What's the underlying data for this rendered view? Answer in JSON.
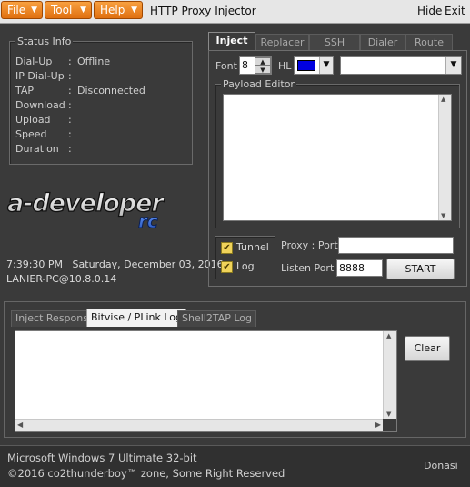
{
  "menu": {
    "file": "File",
    "tool": "Tool",
    "help": "Help"
  },
  "window": {
    "title": "HTTP Proxy Injector",
    "hide": "Hide",
    "exit": "Exit"
  },
  "status_info": {
    "legend": "Status Info",
    "rows": [
      {
        "label": "Dial-Up",
        "value": "Offline"
      },
      {
        "label": "IP Dial-Up",
        "value": ""
      },
      {
        "label": "TAP",
        "value": "Disconnected"
      },
      {
        "label": "Download",
        "value": ""
      },
      {
        "label": "Upload",
        "value": ""
      },
      {
        "label": "Speed",
        "value": ""
      },
      {
        "label": "Duration",
        "value": ""
      }
    ]
  },
  "clock": {
    "time": "7:39:30 PM",
    "date": "Saturday, December 03, 2016",
    "host": "LANIER-PC@10.8.0.14"
  },
  "tabs": [
    "Inject",
    "Replacer",
    "SSH",
    "Dialer",
    "Route"
  ],
  "inject": {
    "font_label": "Font",
    "font_value": "8",
    "hl_label": "HL",
    "hl_color": "#0000e0",
    "payload_legend": "Payload Editor",
    "tunnel_label": "Tunnel",
    "log_label": "Log",
    "proxy_port_label": "Proxy : Port",
    "proxy_port_value": "",
    "listen_port_label": "Listen Port",
    "listen_port_value": "8888",
    "start_label": "START"
  },
  "log_tabs": [
    "Inject Respons",
    "Bitvise / PLink Log",
    "Shell2TAP Log"
  ],
  "log": {
    "clear_label": "Clear"
  },
  "footer": {
    "os": "Microsoft Windows 7 Ultimate  32-bit",
    "copyright": "©2016 co2thunderboy™ zone, Some Right Reserved",
    "donate": "Donasi"
  },
  "colors": {
    "menu_orange": "#f08a24",
    "background": "#3a3a3a",
    "logo_blue": "#2a5fc8"
  },
  "icons": {
    "dropdown": "chevron-down-icon",
    "spin_up": "caret-up-icon",
    "spin_down": "caret-down-icon",
    "check": "checkmark-icon"
  }
}
